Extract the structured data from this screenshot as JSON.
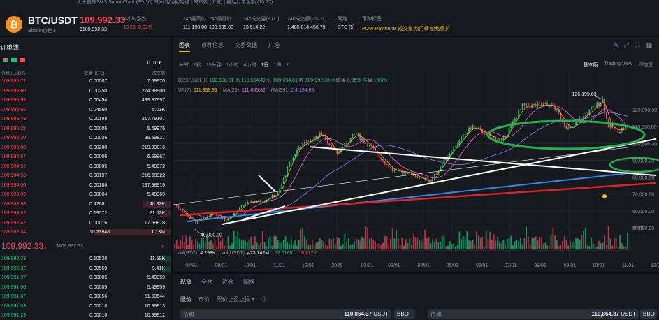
{
  "top_strip": "大于支撑SMS Smart Chart (8D 16) 时间 相场初始格 | 成本价 (价值) | 最后订单金额 (10 27)",
  "ticker": {
    "coin_glyph": "₿",
    "symbol": "BTC/USDT",
    "sub": "Bitcoin价格 ▸",
    "last_price": "109,992.33",
    "last_price_usd": "$109,992.33",
    "stats": [
      {
        "label": "24小时涨跌",
        "value": "-18.66 -0.02%",
        "tone": "red"
      },
      {
        "label": "24h最高价",
        "value": "111,190.00",
        "tone": "normal"
      },
      {
        "label": "24h最低价",
        "value": "108,635.00",
        "tone": "normal"
      },
      {
        "label": "24h成交量(BTC)",
        "value": "13,514.22",
        "tone": "normal"
      },
      {
        "label": "24h成交额(USDT)",
        "value": "1,485,814,456.79",
        "tone": "normal"
      },
      {
        "label": "网络",
        "value": "BTC (5)",
        "tone": "normal"
      },
      {
        "label": "币种标签",
        "value": "POW  Payments  成交量  热门榜  价格保护",
        "tone": "yellow"
      }
    ]
  },
  "orderbook": {
    "title": "订单簿",
    "decimals": "0.01 ▾",
    "col_price": "价格 (USDT)",
    "col_qty": "数量 (BTC)",
    "col_total": "成交额",
    "asks": [
      {
        "p": "109,995.72",
        "q": "0.00007",
        "t": "7.69970",
        "d": 0
      },
      {
        "p": "109,995.60",
        "q": "0.00250",
        "t": "274.98900",
        "d": 0
      },
      {
        "p": "109,995.59",
        "q": "0.00454",
        "t": "499.37997",
        "d": 0
      },
      {
        "p": "109,995.56",
        "q": "0.04560",
        "t": "5.01K",
        "d": 0
      },
      {
        "p": "109,995.49",
        "q": "0.00198",
        "t": "217.79107",
        "d": 0
      },
      {
        "p": "109,995.25",
        "q": "0.00005",
        "t": "5.49976",
        "d": 0
      },
      {
        "p": "109,995.20",
        "q": "0.00036",
        "t": "39.59827",
        "d": 0
      },
      {
        "p": "109,995.08",
        "q": "0.00200",
        "t": "219.99016",
        "d": 0
      },
      {
        "p": "109,994.57",
        "q": "0.00006",
        "t": "6.59967",
        "d": 0
      },
      {
        "p": "109,994.56",
        "q": "0.00005",
        "t": "5.49972",
        "d": 0
      },
      {
        "p": "109,994.53",
        "q": "0.00197",
        "t": "216.68922",
        "d": 0
      },
      {
        "p": "109,994.00",
        "q": "0.00180",
        "t": "197.98919",
        "d": 0
      },
      {
        "p": "109,993.99",
        "q": "0.00004",
        "t": "5.49969",
        "d": 0
      },
      {
        "p": "109,993.98",
        "q": "0.42661",
        "t": "46.92K",
        "d": 0.33
      },
      {
        "p": "109,993.97",
        "q": "0.19572",
        "t": "21.52K",
        "d": 0.15
      },
      {
        "p": "109,992.42",
        "q": "0.00016",
        "t": "17.59878",
        "d": 0
      },
      {
        "p": "109,992.34",
        "q": "10.33648",
        "t": "1.13M",
        "d": 0.92
      }
    ],
    "mid_price": "109,992.33↓",
    "mid_usd": "$109,992.33",
    "bids": [
      {
        "p": "109,992.33",
        "q": "0.10530",
        "t": "11.58K",
        "d": 0.12
      },
      {
        "p": "109,992.32",
        "q": "0.08559",
        "t": "9.41K",
        "d": 0.1
      },
      {
        "p": "109,991.97",
        "q": "0.00005",
        "t": "5.49959",
        "d": 0
      },
      {
        "p": "109,991.90",
        "q": "0.00005",
        "t": "5.49959",
        "d": 0
      },
      {
        "p": "109,991.87",
        "q": "0.00056",
        "t": "61.59544",
        "d": 0
      },
      {
        "p": "109,991.33",
        "q": "0.00010",
        "t": "10.99913",
        "d": 0
      },
      {
        "p": "109,991.29",
        "q": "0.00010",
        "t": "10.99912",
        "d": 0
      }
    ]
  },
  "chart_panel": {
    "tabs": [
      "图表",
      "币种信息",
      "交易数据",
      "广场"
    ],
    "timeframes": [
      "分时",
      "1秒",
      "15分钟",
      "1小时",
      "4小时",
      "1日",
      "1周",
      "▾"
    ],
    "views": [
      "基本版",
      "Trading View",
      "深度图"
    ],
    "ohlc": {
      "date": "2025/11/01",
      "open_label": "开",
      "open": "109,608.01",
      "high_label": "高",
      "high": "110,564.49",
      "low_label": "低",
      "low": "109,394.81",
      "close_label": "收",
      "close": "109,992.33",
      "change_label": "涨跌幅",
      "change": "0.35%",
      "amp_label": "振幅",
      "amp": "1.06%"
    },
    "ma": [
      {
        "label": "MA(7):",
        "value": "111,358.81",
        "color": "#f0b90b"
      },
      {
        "label": "MA(25):",
        "value": "111,655.82",
        "color": "#e36bd8"
      },
      {
        "label": "MA(99):",
        "value": "114,194.65",
        "color": "#8f7ff5"
      }
    ],
    "vol": [
      {
        "label": "Vol(BTC):",
        "value": "4.299K",
        "color": "#eaecef"
      },
      {
        "label": "Vol(USDT):",
        "value": "473.142M",
        "color": "#eaecef"
      },
      {
        "label": "",
        "value": "17.616K",
        "color": "#0ecb81"
      },
      {
        "label": "",
        "value": "18.772K",
        "color": "#f6465d"
      }
    ],
    "price_axis": [
      "120,000.00",
      "110,000.00",
      "100,000.00",
      "90,000.00",
      "80,000.00",
      "70,000.00",
      "60,000.00",
      "50,000.00"
    ],
    "vol_axis": "100K",
    "x_axis": [
      "08/01",
      "09/01",
      "10/01",
      "11/01",
      "12/01",
      "2025",
      "02/01",
      "03/01",
      "04/01",
      "05/01",
      "06/01",
      "07/01",
      "08/01",
      "09/01",
      "10/01",
      "11/01",
      "12/01"
    ],
    "high_marker": "126,199.63",
    "low_marker": "49,000.00"
  },
  "trade_panel": {
    "tabs": [
      "现货",
      "全仓",
      "逐仓",
      "网格"
    ],
    "order_types": [
      "限价",
      "市价",
      "限价止盈止损 ▾",
      "ⓘ"
    ],
    "price_label": "价格",
    "price_value": "110,864.37",
    "unit": "USDT",
    "bbo": "BBO"
  },
  "chart_data": {
    "type": "candlestick",
    "timeframe": "1日",
    "x_range": [
      "2024-07-15",
      "2025-11-01"
    ],
    "y_range": [
      45000,
      130000
    ],
    "x_ticks": [
      "08/01",
      "09/01",
      "10/01",
      "11/01",
      "12/01",
      "2025",
      "02/01",
      "03/01",
      "04/01",
      "05/01",
      "06/01",
      "07/01",
      "08/01",
      "09/01",
      "10/01",
      "11/01",
      "12/01"
    ],
    "y_ticks": [
      50000,
      60000,
      70000,
      80000,
      90000,
      100000,
      110000,
      120000
    ],
    "close_path": [
      {
        "x": "2024-07-15",
        "y": 64000
      },
      {
        "x": "2024-08-05",
        "y": 53000
      },
      {
        "x": "2024-08-25",
        "y": 59000
      },
      {
        "x": "2024-09-06",
        "y": 54000
      },
      {
        "x": "2024-09-28",
        "y": 65000
      },
      {
        "x": "2024-10-15",
        "y": 66000
      },
      {
        "x": "2024-10-31",
        "y": 70000
      },
      {
        "x": "2024-11-12",
        "y": 88000
      },
      {
        "x": "2024-11-22",
        "y": 98000
      },
      {
        "x": "2024-12-17",
        "y": 106000
      },
      {
        "x": "2024-12-31",
        "y": 93500
      },
      {
        "x": "2025-01-20",
        "y": 106000
      },
      {
        "x": "2025-02-05",
        "y": 98000
      },
      {
        "x": "2025-02-28",
        "y": 84000
      },
      {
        "x": "2025-03-15",
        "y": 83000
      },
      {
        "x": "2025-04-08",
        "y": 77000
      },
      {
        "x": "2025-05-01",
        "y": 96000
      },
      {
        "x": "2025-05-22",
        "y": 110000
      },
      {
        "x": "2025-06-22",
        "y": 101000
      },
      {
        "x": "2025-07-14",
        "y": 122000
      },
      {
        "x": "2025-08-14",
        "y": 123000
      },
      {
        "x": "2025-09-01",
        "y": 108000
      },
      {
        "x": "2025-09-18",
        "y": 117000
      },
      {
        "x": "2025-10-06",
        "y": 126199
      },
      {
        "x": "2025-10-11",
        "y": 111000
      },
      {
        "x": "2025-10-22",
        "y": 107500
      },
      {
        "x": "2025-11-01",
        "y": 109992
      }
    ],
    "annotations": [
      {
        "text": "126,199.63",
        "x": "2025-10-06",
        "y": 126199
      },
      {
        "text": "49,000.00",
        "x": "2024-08-05",
        "y": 49000
      }
    ]
  }
}
